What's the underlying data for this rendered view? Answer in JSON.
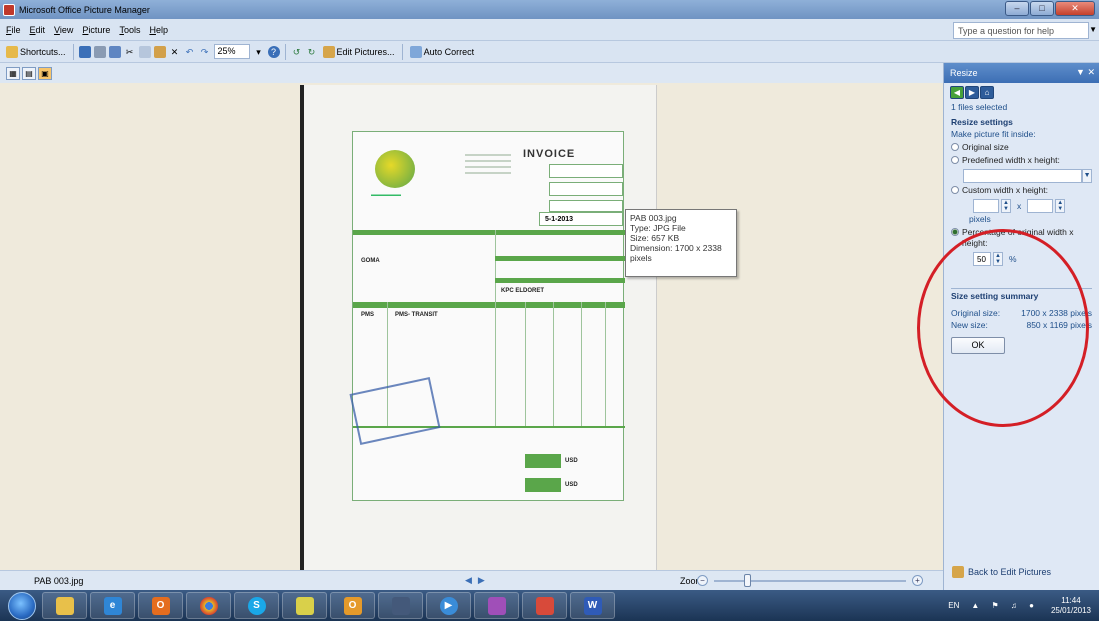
{
  "window": {
    "title": "Microsoft Office Picture Manager"
  },
  "menu": [
    "File",
    "Edit",
    "View",
    "Picture",
    "Tools",
    "Help"
  ],
  "help_box": {
    "placeholder": "Type a question for help"
  },
  "toolbar": {
    "shortcuts": "Shortcuts...",
    "zoom_value": "25%",
    "edit_pictures": "Edit Pictures...",
    "auto_correct": "Auto Correct"
  },
  "invoice": {
    "title": "INVOICE",
    "date": "5-1-2013",
    "destination": "GOMA",
    "depot": "KPC ELDORET",
    "product": "PMS",
    "product_desc": "PMS- TRANSIT",
    "currency1": "USD",
    "currency2": "USD"
  },
  "tooltip": {
    "filename": "PAB 003.jpg",
    "type": "Type: JPG File",
    "size": "Size: 657 KB",
    "dimension": "Dimension: 1700 x 2338 pixels"
  },
  "status": {
    "filename": "PAB 003.jpg",
    "zoom_label": "Zoom:",
    "zoom_fraction": 0.17
  },
  "taskpane": {
    "title": "Resize",
    "files_selected": "1 files selected",
    "resize_settings": "Resize settings",
    "fit_inside": "Make picture fit inside:",
    "opt_original": "Original size",
    "opt_predefined": "Predefined width x height:",
    "opt_custom": "Custom width x height:",
    "x_label": "x",
    "pixels": "pixels",
    "opt_percentage": "Percentage of original width x height:",
    "percent_value": "50",
    "percent_sign": "%",
    "summary_title": "Size setting summary",
    "original_size_label": "Original size:",
    "original_size_value": "1700 x 2338 pixels",
    "new_size_label": "New size:",
    "new_size_value": "850 x 1169 pixels",
    "ok": "OK",
    "back": "Back to Edit Pictures"
  },
  "tray": {
    "lang": "EN",
    "time": "11:44",
    "date": "25/01/2013"
  },
  "colors": {
    "annotation": "#d41f26",
    "invoice_green": "#5aa64a",
    "taskpane_header": "#3c6eb4"
  }
}
